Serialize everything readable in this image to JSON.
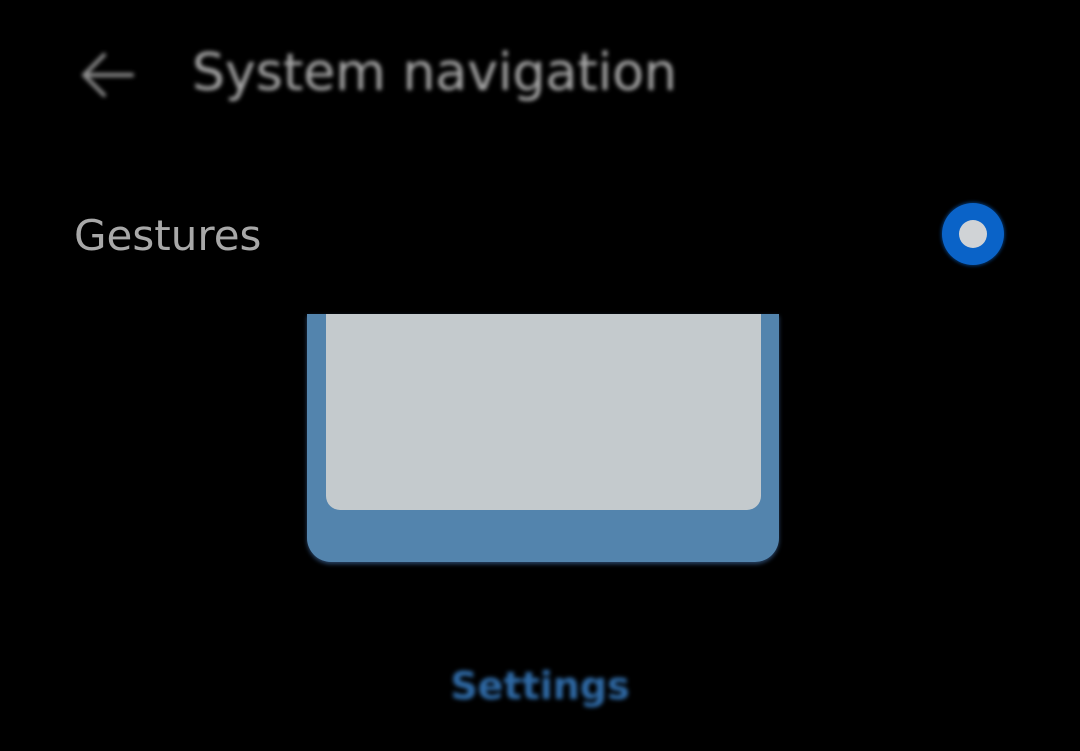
{
  "header": {
    "back_icon": "arrow-left-icon",
    "title": "System navigation"
  },
  "option": {
    "label": "Gestures",
    "selected": true,
    "accent_color": "#0a63c8"
  },
  "illustration": {
    "frame_color": "#5384ad",
    "screen_color": "#c4cacd"
  },
  "footer": {
    "settings_label": "Settings",
    "link_color": "#2f6aa6"
  },
  "colors": {
    "background": "#000000",
    "text_primary": "#a8a8a8"
  }
}
